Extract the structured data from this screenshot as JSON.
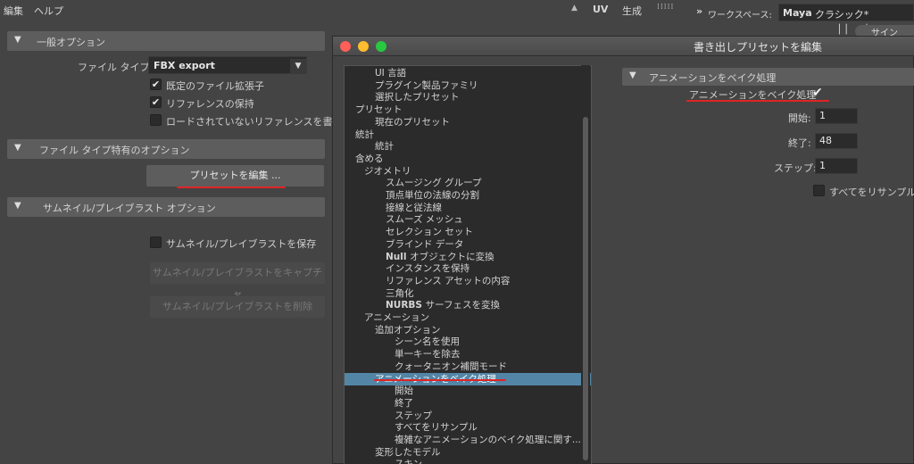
{
  "menubar": {
    "edit": "編集",
    "help": "ヘルプ",
    "uv": "UV",
    "generate": "生成",
    "workspace_label": "ワークスペース:",
    "workspace_value_bold": "Maya",
    "workspace_value_rest": "クラシック*",
    "chevrons": "»",
    "signin_partial": "サイン"
  },
  "left_panel": {
    "general_options": {
      "header": "一般オプション",
      "file_type_label": "ファイル タイプ:",
      "file_type_value": "FBX export",
      "default_extension": "既定のファイル拡張子",
      "preserve_references": "リファレンスの保持",
      "unloaded_references": "ロードされていないリファレンスを書き出",
      "default_extension_checked": true,
      "preserve_references_checked": true,
      "unloaded_references_checked": false
    },
    "file_type_specific": {
      "header": "ファイル タイプ特有のオプション",
      "edit_presets_button": "プリセットを編集 ..."
    },
    "thumbnail": {
      "header": "サムネイル/プレイブラスト オプション",
      "save_label": "サムネイル/プレイブラストを保存",
      "capture_button": "サムネイル/プレイブラストをキャプチャ",
      "delete_button": "サムネイル/プレイブラストを削除"
    }
  },
  "dialog": {
    "title": "書き出しプリセットを編集",
    "tree": [
      {
        "label": "UI 言語",
        "indent": 2,
        "bold": false
      },
      {
        "label": "プラグイン製品ファミリ",
        "indent": 2,
        "bold": false
      },
      {
        "label": "選択したプリセット",
        "indent": 2,
        "bold": false
      },
      {
        "label": "プリセット",
        "indent": 0,
        "bold": false
      },
      {
        "label": "現在のプリセット",
        "indent": 2,
        "bold": false
      },
      {
        "label": "統計",
        "indent": 0,
        "bold": false
      },
      {
        "label": "統計",
        "indent": 2,
        "bold": false
      },
      {
        "label": "含める",
        "indent": 0,
        "bold": false
      },
      {
        "label": "ジオメトリ",
        "indent": 1,
        "bold": false
      },
      {
        "label": "スムージング グループ",
        "indent": 3,
        "bold": false
      },
      {
        "label": "頂点単位の法線の分割",
        "indent": 3,
        "bold": false
      },
      {
        "label": "接線と従法線",
        "indent": 3,
        "bold": false
      },
      {
        "label": "スムーズ メッシュ",
        "indent": 3,
        "bold": false
      },
      {
        "label": "セレクション セット",
        "indent": 3,
        "bold": false
      },
      {
        "label": "ブラインド データ",
        "indent": 3,
        "bold": false
      },
      {
        "label": "オブジェクトに変換",
        "indent": 3,
        "bold": true,
        "bold_prefix": "Null"
      },
      {
        "label": "インスタンスを保持",
        "indent": 3,
        "bold": false
      },
      {
        "label": "リファレンス アセットの内容",
        "indent": 3,
        "bold": false
      },
      {
        "label": "三角化",
        "indent": 3,
        "bold": false
      },
      {
        "label": "サーフェスを変換",
        "indent": 3,
        "bold": true,
        "bold_prefix": "NURBS"
      },
      {
        "label": "アニメーション",
        "indent": 1,
        "bold": false
      },
      {
        "label": "追加オプション",
        "indent": 2,
        "bold": false
      },
      {
        "label": "シーン名を使用",
        "indent": 4,
        "bold": false
      },
      {
        "label": "単一キーを除去",
        "indent": 4,
        "bold": false
      },
      {
        "label": "クォータニオン補間モード",
        "indent": 4,
        "bold": false
      },
      {
        "label": "アニメーションをベイク処理",
        "indent": 2,
        "bold": false,
        "selected": true
      },
      {
        "label": "開始",
        "indent": 4,
        "bold": false
      },
      {
        "label": "終了",
        "indent": 4,
        "bold": false
      },
      {
        "label": "ステップ",
        "indent": 4,
        "bold": false
      },
      {
        "label": "すべてをリサンプル",
        "indent": 4,
        "bold": false
      },
      {
        "label": "複雑なアニメーションのベイク処理に関す...",
        "indent": 4,
        "bold": false
      },
      {
        "label": "変形したモデル",
        "indent": 2,
        "bold": false
      },
      {
        "label": "スキン",
        "indent": 4,
        "bold": false
      }
    ],
    "right": {
      "header": "アニメーションをベイク処理",
      "bake_label": "アニメーションをベイク処理",
      "bake_checked": true,
      "start_label": "開始:",
      "start_value": "1",
      "end_label": "終了:",
      "end_value": "48",
      "step_label": "ステップ:",
      "step_value": "1",
      "resample_label": "すべてをリサンプル",
      "resample_checked": false
    }
  },
  "colors": {
    "background": "#444444",
    "section_header": "#5d5d5d",
    "field": "#2b2b2b",
    "selection": "#5285a6",
    "annotation_red": "#e02424"
  }
}
